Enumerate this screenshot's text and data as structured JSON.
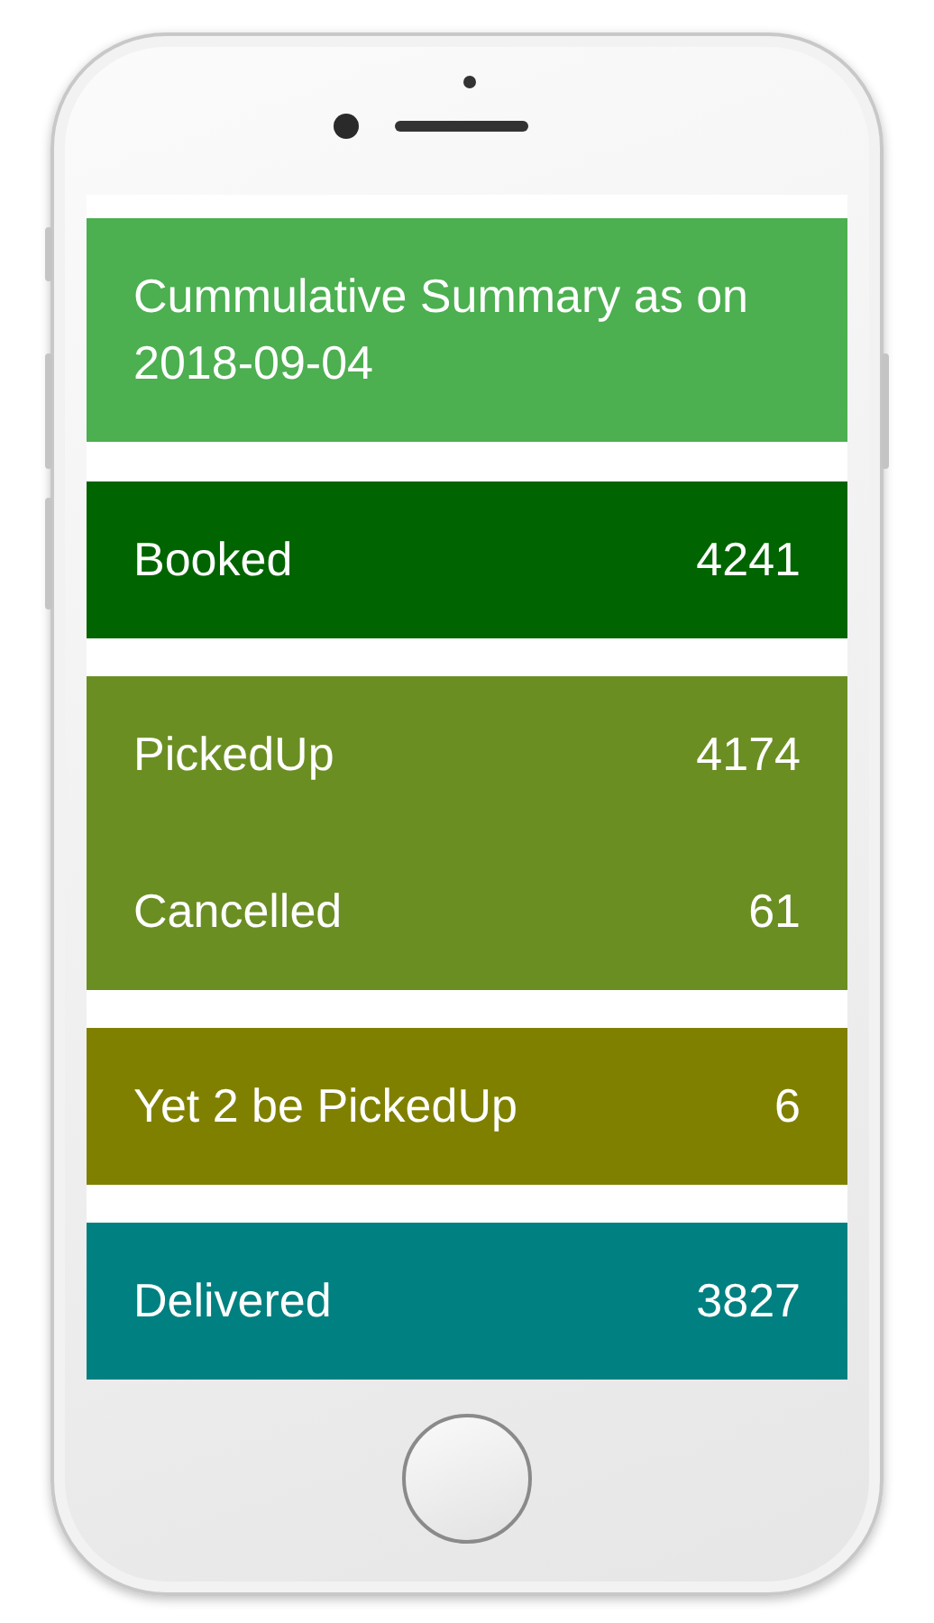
{
  "summary": {
    "title": "Cummulative Summary as on 2018-09-04"
  },
  "groups": [
    {
      "color": "#006400",
      "rows": [
        {
          "label": "Booked",
          "value": "4241"
        }
      ]
    },
    {
      "color": "#6b8e23",
      "rows": [
        {
          "label": "PickedUp",
          "value": "4174"
        },
        {
          "label": "Cancelled",
          "value": "61"
        }
      ]
    },
    {
      "color": "#808000",
      "rows": [
        {
          "label": "Yet 2 be PickedUp",
          "value": "6"
        }
      ]
    },
    {
      "color": "#008080",
      "rows": [
        {
          "label": "Delivered",
          "value": "3827"
        }
      ]
    }
  ]
}
